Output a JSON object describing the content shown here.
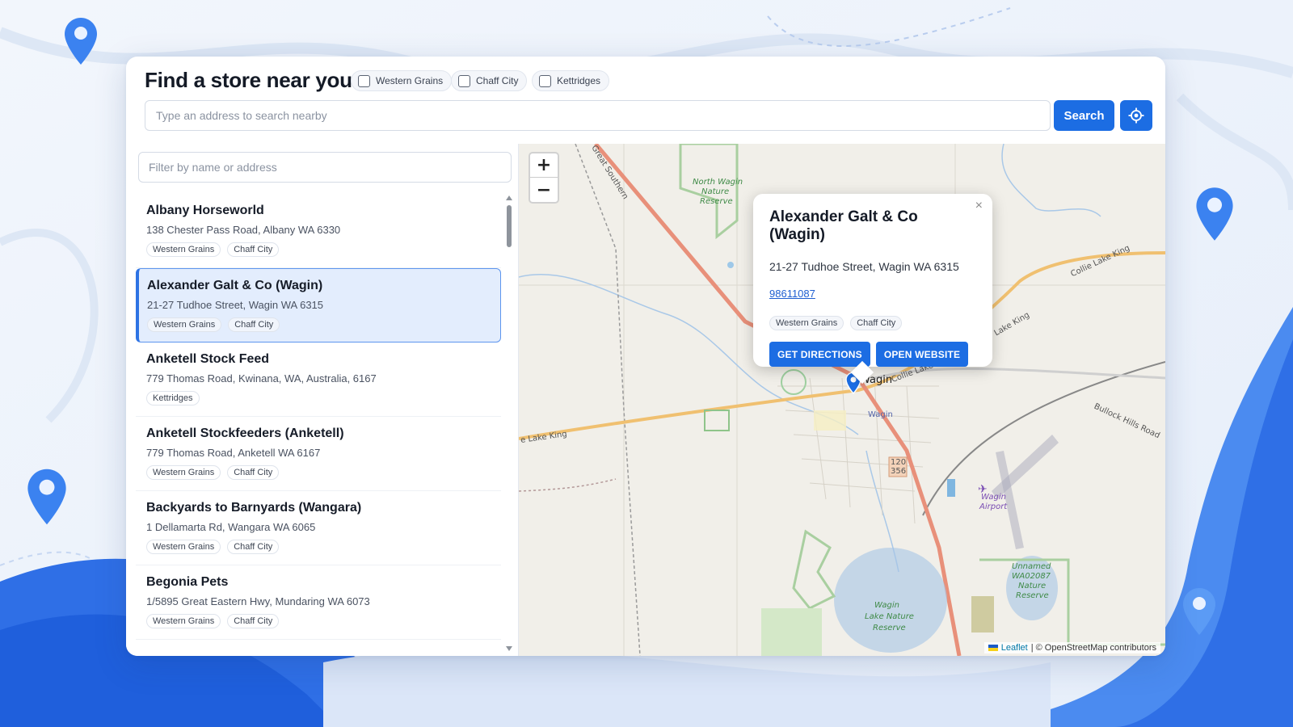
{
  "header": {
    "title": "Find a store near you",
    "filters": [
      "Western Grains",
      "Chaff City",
      "Kettridges"
    ],
    "search_placeholder": "Type an address to search nearby",
    "search_button": "Search"
  },
  "sidebar": {
    "filter_placeholder": "Filter by name or address",
    "stores": [
      {
        "name": "Albany Horseworld",
        "address": "138 Chester Pass Road, Albany WA 6330",
        "tags": [
          "Western Grains",
          "Chaff City"
        ]
      },
      {
        "name": "Alexander Galt & Co (Wagin)",
        "address": "21-27 Tudhoe Street, Wagin WA 6315",
        "tags": [
          "Western Grains",
          "Chaff City"
        ]
      },
      {
        "name": "Anketell Stock Feed",
        "address": "779 Thomas Road, Kwinana, WA, Australia, 6167",
        "tags": [
          "Kettridges"
        ]
      },
      {
        "name": "Anketell Stockfeeders (Anketell)",
        "address": "779 Thomas Road, Anketell WA 6167",
        "tags": [
          "Western Grains",
          "Chaff City"
        ]
      },
      {
        "name": "Backyards to Barnyards (Wangara)",
        "address": "1 Dellamarta Rd, Wangara WA 6065",
        "tags": [
          "Western Grains",
          "Chaff City"
        ]
      },
      {
        "name": "Begonia Pets",
        "address": "1/5895 Great Eastern Hwy, Mundaring WA 6073",
        "tags": [
          "Western Grains",
          "Chaff City"
        ]
      }
    ]
  },
  "map": {
    "zoom_in": "+",
    "zoom_out": "−",
    "labels": {
      "north_wagin": "North Wagin",
      "nature": "Nature",
      "reserve": "Reserve",
      "town": "Wagin",
      "town_small": "Wagin",
      "collie_lake_king": "Collie Lake King",
      "collie_lake": "Collie Lake",
      "lake_king": "Lake King",
      "e_lake_king": "e Lake King",
      "bullock_hills": "Bullock Hills Road",
      "airport_1": "Wagin",
      "airport_2": "Airport",
      "route_1": "120",
      "route_2": "356",
      "lake_1": "Wagin",
      "lake_2": "Lake Nature",
      "lake_3": "Reserve",
      "unnamed_1": "Unnamed",
      "unnamed_2": "WA02087",
      "unnamed_3": "Nature",
      "unnamed_4": "Reserve",
      "great_southern": "Great Southern"
    },
    "popup": {
      "title": "Alexander Galt & Co (Wagin)",
      "address": "21-27 Tudhoe Street, Wagin WA 6315",
      "phone": "98611087",
      "tags": [
        "Western Grains",
        "Chaff City"
      ],
      "directions": "GET DIRECTIONS",
      "website": "OPEN WEBSITE",
      "close": "×"
    },
    "attribution": {
      "leaflet": "Leaflet",
      "osm": "| © OpenStreetMap contributors"
    }
  },
  "colors": {
    "accent": "#1c6de3",
    "selected_bg": "#e3edfd",
    "map_bg": "#f1efe9"
  }
}
